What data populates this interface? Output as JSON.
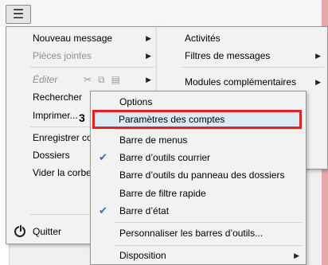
{
  "main_menu": {
    "items": [
      {
        "label": "Nouveau message",
        "arrow": "▶"
      },
      {
        "label": "Pièces jointes",
        "arrow": "▶"
      },
      {
        "label": "Éditer",
        "arrow": "▶"
      },
      {
        "label": "Rechercher"
      },
      {
        "label": "Imprimer..."
      },
      {
        "label": "Enregistrer cor"
      },
      {
        "label": "Dossiers"
      },
      {
        "label": "Vider la corbei"
      },
      {
        "label": "Quitter"
      }
    ],
    "step_marker": "3"
  },
  "side_menu": {
    "items": [
      {
        "label": "Activités"
      },
      {
        "label": "Filtres de messages",
        "arrow": "▶"
      },
      {
        "label": "Modules complémentaires",
        "arrow": "▶"
      }
    ]
  },
  "options_submenu": {
    "items": [
      {
        "label": "Options"
      },
      {
        "label": "Paramètres des comptes"
      },
      {
        "label": "Barre de menus"
      },
      {
        "label": "Barre d’outils courrier",
        "checked": true
      },
      {
        "label": "Barre d’outils du panneau des dossiers"
      },
      {
        "label": "Barre de filtre rapide"
      },
      {
        "label": "Barre d’état",
        "checked": true
      },
      {
        "label": "Personnaliser les barres d’outils..."
      },
      {
        "label": "Disposition",
        "arrow": "▶"
      }
    ]
  },
  "icons": {
    "menu": "☰",
    "check": "✔",
    "edit_tools": "✂⧉▤"
  },
  "colors": {
    "highlight_border": "#e52222",
    "check": "#2a6fc9"
  }
}
